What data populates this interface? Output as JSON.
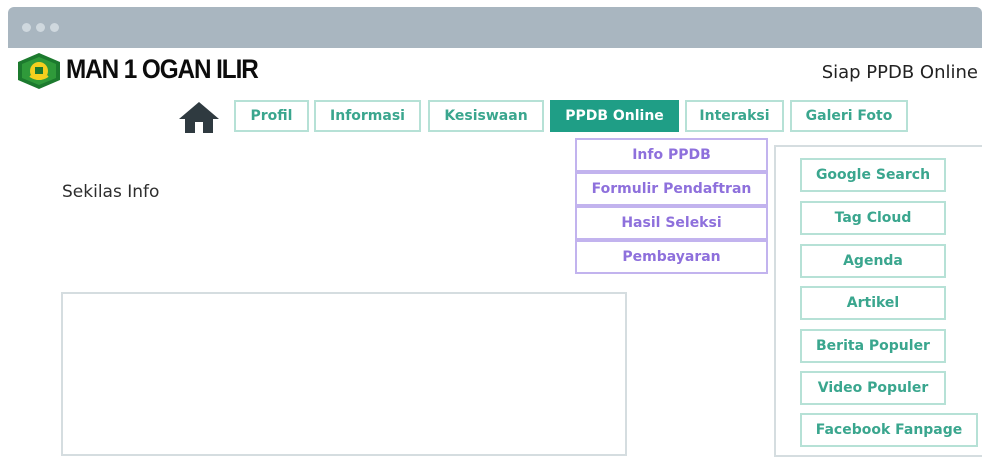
{
  "brand": {
    "name": "MAN 1 OGAN ILIR",
    "tagline": "Siap PPDB Online"
  },
  "nav": {
    "items": [
      {
        "label": "Profil"
      },
      {
        "label": "Informasi"
      },
      {
        "label": "Kesiswaan"
      },
      {
        "label": "PPDB Online",
        "active": true
      },
      {
        "label": "Interaksi"
      },
      {
        "label": "Galeri Foto"
      }
    ]
  },
  "dropdown": {
    "items": [
      {
        "label": "Info PPDB"
      },
      {
        "label": "Formulir Pendaftran"
      },
      {
        "label": "Hasil Seleksi"
      },
      {
        "label": "Pembayaran"
      }
    ]
  },
  "main": {
    "heading": "Sekilas Info"
  },
  "sidebar": {
    "items": [
      {
        "label": "Google Search"
      },
      {
        "label": "Tag Cloud"
      },
      {
        "label": "Agenda"
      },
      {
        "label": "Artikel"
      },
      {
        "label": "Berita Populer"
      },
      {
        "label": "Video Populer"
      },
      {
        "label": "Facebook Fanpage"
      }
    ]
  },
  "colors": {
    "accent": "#1f9e86",
    "menu_text": "#3aa68e",
    "dropdown_text": "#8e70dc",
    "titlebar": "#a9b6c0"
  },
  "icons": {
    "home": "home-icon",
    "logo": "kemenag-logo-icon"
  }
}
